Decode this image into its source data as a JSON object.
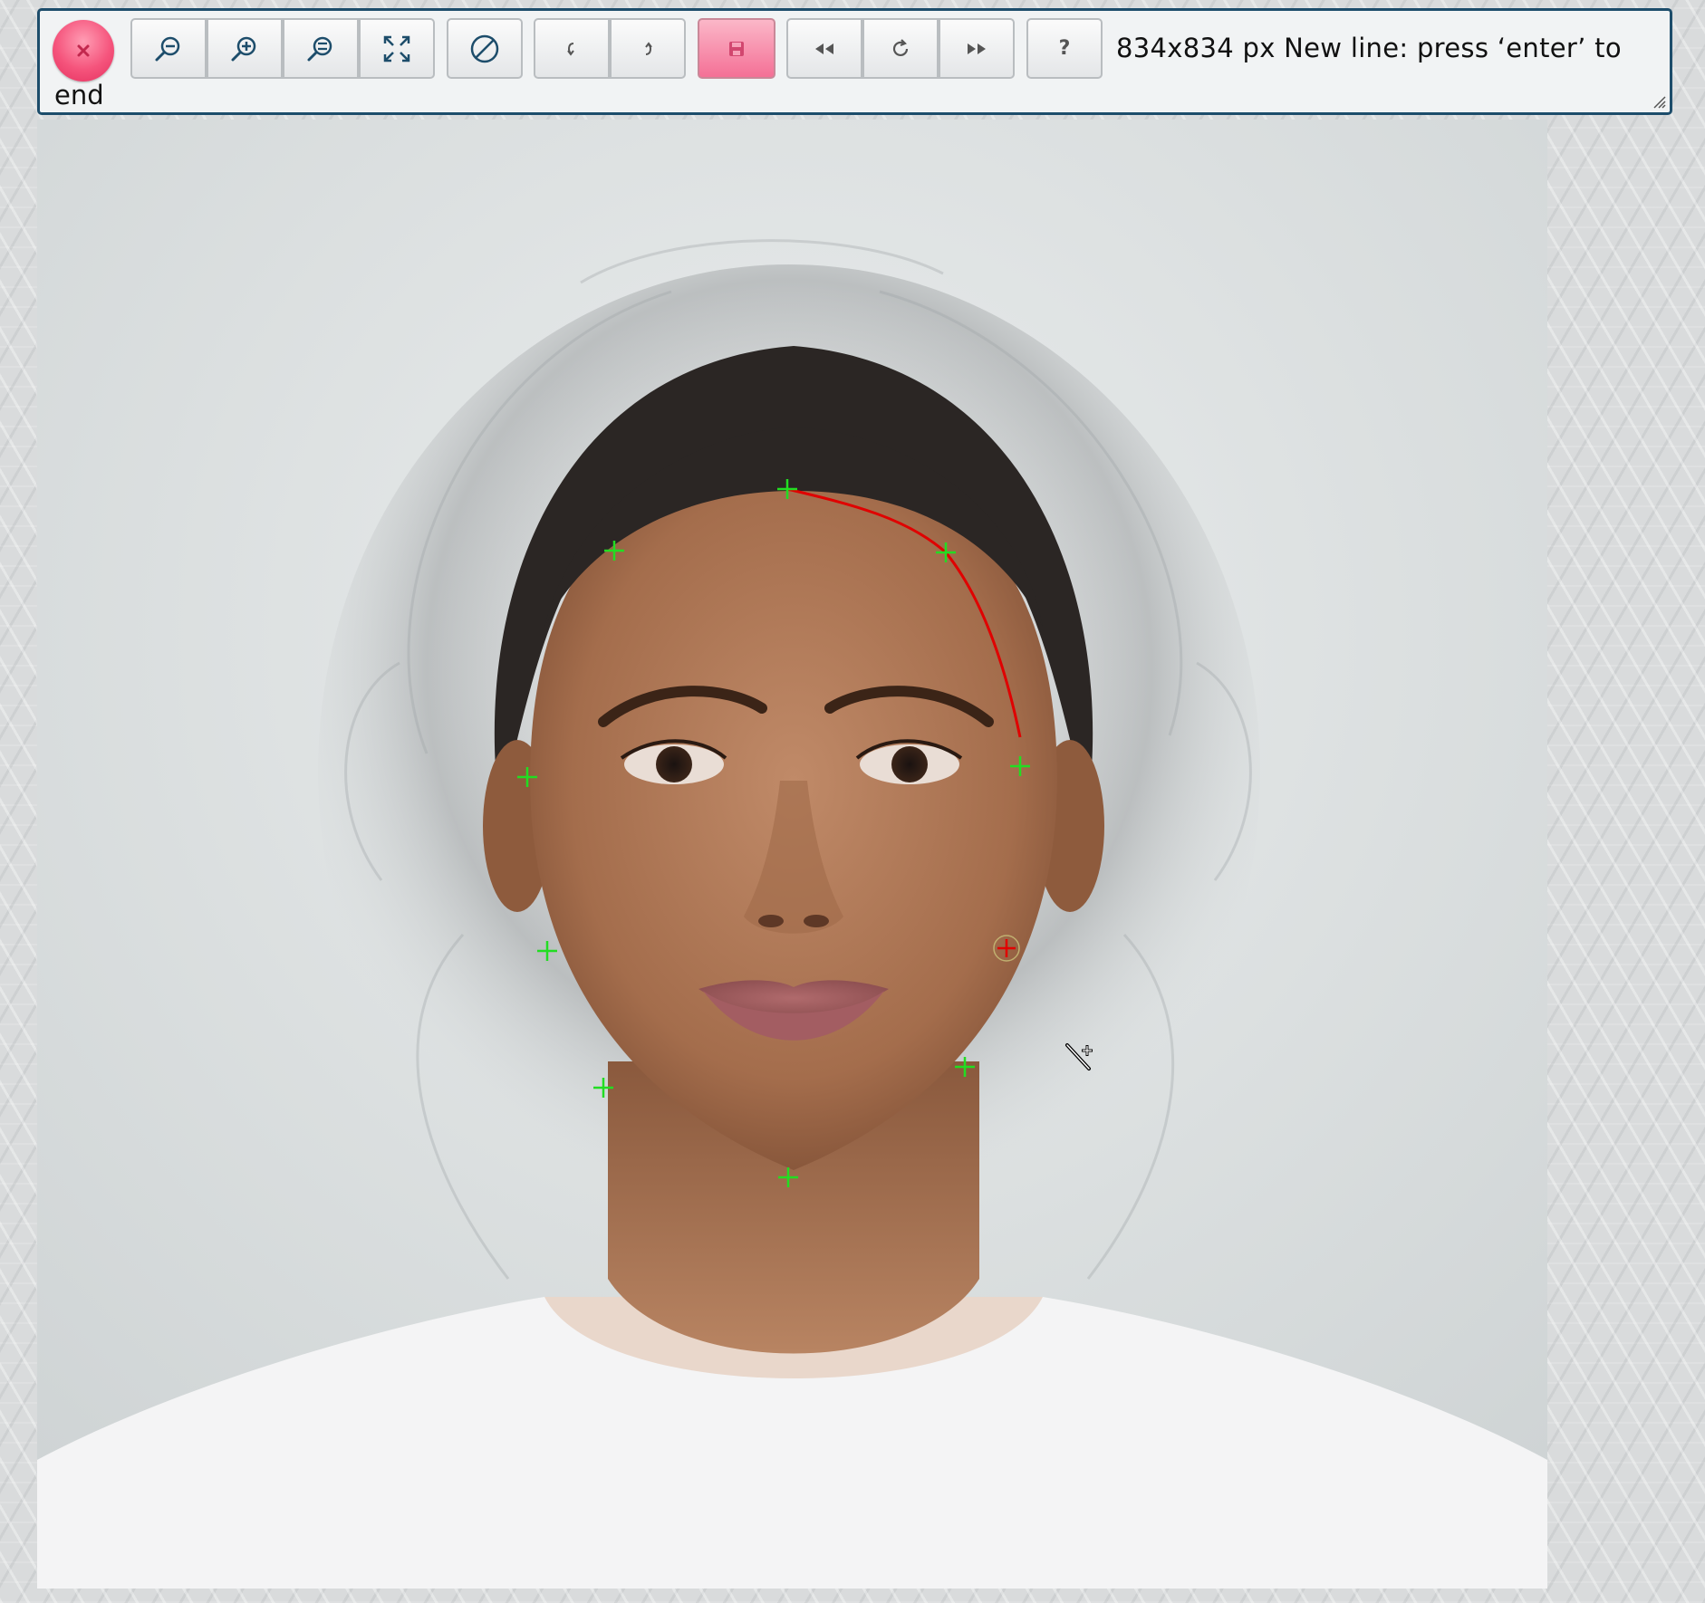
{
  "toolbar": {
    "status_text": "834x834 px New line: press ‘enter’ to",
    "status_text_wrap": "end",
    "buttons": [
      {
        "name": "close-button",
        "icon": "close-icon"
      },
      {
        "name": "zoom-out-button",
        "icon": "zoom-out-icon"
      },
      {
        "name": "zoom-in-button",
        "icon": "zoom-in-icon"
      },
      {
        "name": "zoom-reset-button",
        "icon": "zoom-reset-icon"
      },
      {
        "name": "fit-to-window-button",
        "icon": "expand-icon"
      },
      {
        "name": "clear-button",
        "icon": "no-entry-icon"
      },
      {
        "name": "undo-button",
        "icon": "undo-icon"
      },
      {
        "name": "redo-button",
        "icon": "redo-icon"
      },
      {
        "name": "save-button",
        "icon": "save-icon"
      },
      {
        "name": "previous-button",
        "icon": "rewind-icon"
      },
      {
        "name": "refresh-button",
        "icon": "refresh-icon"
      },
      {
        "name": "next-button",
        "icon": "fast-forward-icon"
      },
      {
        "name": "help-button",
        "icon": "question-icon",
        "label": "?"
      }
    ]
  },
  "colors": {
    "toolbar_border": "#1d4d6b",
    "accent_pink": "#f47096",
    "landmark_green": "#22dd22",
    "active_line_red": "#e00000",
    "photo_background": "#dfe3e4"
  },
  "image": {
    "description_icon": "face-photo",
    "landmarks_count": 10
  }
}
